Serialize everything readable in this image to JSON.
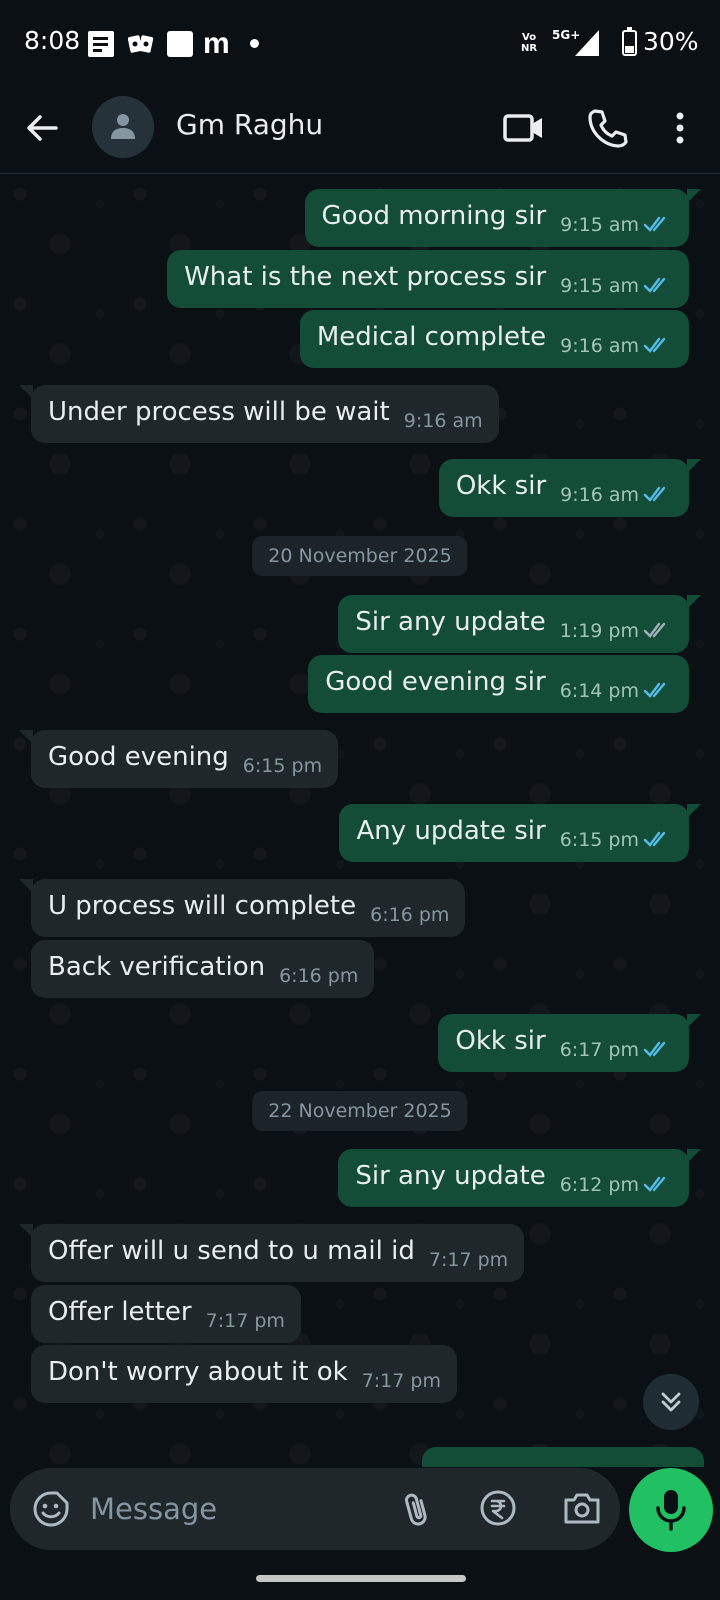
{
  "status_bar": {
    "time": "8:08",
    "network_top": "Vo",
    "network_bottom": "NR",
    "network_type": "5G+",
    "battery": "30%",
    "notification_glyph": "m"
  },
  "header": {
    "contact_name": "Gm Raghu",
    "icons": [
      "back-arrow-icon",
      "avatar",
      "video-call-icon",
      "phone-icon",
      "more-options-icon"
    ]
  },
  "chat": {
    "messages": [
      {
        "dir": "out",
        "text": "Good morning sir",
        "time": "9:15 am",
        "status": "read"
      },
      {
        "dir": "out",
        "text": "What is the next process sir",
        "time": "9:15 am",
        "status": "read"
      },
      {
        "dir": "out",
        "text": "Medical complete",
        "time": "9:16 am",
        "status": "read"
      },
      {
        "dir": "in",
        "text": "Under process will be wait",
        "time": "9:16 am"
      },
      {
        "dir": "out",
        "text": "Okk sir",
        "time": "9:16 am",
        "status": "read"
      },
      {
        "dir": "out",
        "text": "Sir any update",
        "time": "1:19 pm",
        "status": "delivered"
      },
      {
        "dir": "out",
        "text": "Good evening sir",
        "time": "6:14 pm",
        "status": "read"
      },
      {
        "dir": "in",
        "text": "Good evening",
        "time": "6:15 pm"
      },
      {
        "dir": "out",
        "text": "Any update sir",
        "time": "6:15 pm",
        "status": "read"
      },
      {
        "dir": "in",
        "text": "U process will complete",
        "time": "6:16 pm"
      },
      {
        "dir": "in",
        "text": "Back verification",
        "time": "6:16 pm"
      },
      {
        "dir": "out",
        "text": "Okk sir",
        "time": "6:17 pm",
        "status": "read"
      },
      {
        "dir": "out",
        "text": "Sir any update",
        "time": "6:12 pm",
        "status": "read"
      },
      {
        "dir": "in",
        "text": "Offer will u send to u mail id",
        "time": "7:17 pm"
      },
      {
        "dir": "in",
        "text": "Offer letter",
        "time": "7:17 pm"
      },
      {
        "dir": "in",
        "text": "Don't worry about it ok",
        "time": "7:17 pm"
      }
    ],
    "date_separators": [
      "20 November 2025",
      "22 November 2025"
    ]
  },
  "composer": {
    "placeholder": "Message"
  },
  "colors": {
    "background": "#0b1014",
    "outgoing_bubble": "#134d37",
    "incoming_bubble": "#1f272b",
    "read_tick": "#53bdeb",
    "accent_green": "#21c063"
  }
}
